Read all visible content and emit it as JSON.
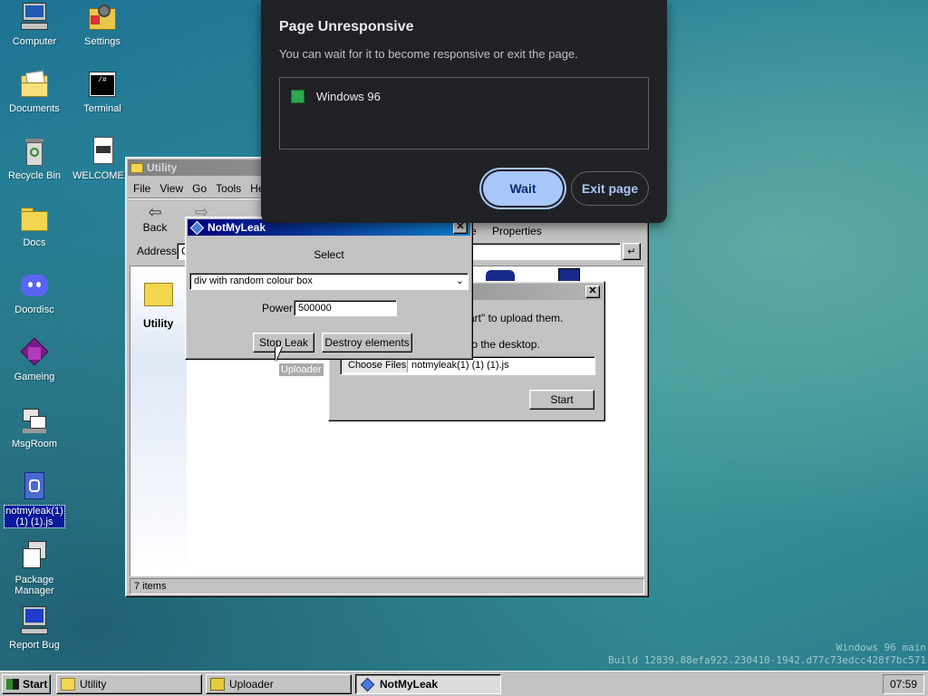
{
  "desktop": {
    "icons": [
      {
        "label": "Computer"
      },
      {
        "label": "Settings"
      },
      {
        "label": "Documents"
      },
      {
        "label": "Terminal"
      },
      {
        "label": "Recycle Bin"
      },
      {
        "label": "WELCOME..."
      },
      {
        "label": "Docs"
      },
      {
        "label": "Doordisc"
      },
      {
        "label": "Gameing"
      },
      {
        "label": "MsgRoom"
      },
      {
        "label": "notmyleak(1)\n(1) (1).js"
      },
      {
        "label": "Package\nManager"
      },
      {
        "label": "Report Bug"
      }
    ],
    "build_line1": "Windows 96 main",
    "build_line2": "Build 12839.88efa922.230410-1942.d77c73edcc428f7bc571"
  },
  "explorer": {
    "title": "Utility",
    "menu": [
      "File",
      "View",
      "Go",
      "Tools",
      "Help"
    ],
    "toolbar": {
      "back": "Back",
      "properties": "Properties",
      "partial": "e"
    },
    "address_label": "Address",
    "address_value": "C",
    "folder_label": "Utility",
    "status": "7 items"
  },
  "uploader": {
    "text1": "art\" to upload them.",
    "text2": "to the desktop.",
    "choose_files": "Choose Files",
    "file_name": "notmyleak(1) (1) (1).js",
    "start": "Start",
    "tooltip": "Uploader"
  },
  "notmyleak": {
    "title": "NotMyLeak",
    "select_label": "Select",
    "select_value": "div with random colour box",
    "power_label": "Power:",
    "power_value": "500000",
    "stop_button": "Stop Leak",
    "destroy_button": "Destroy elements"
  },
  "chrome_dialog": {
    "title": "Page Unresponsive",
    "message": "You can wait for it to become responsive or exit the page.",
    "page_name": "Windows 96",
    "wait": "Wait",
    "exit": "Exit page"
  },
  "taskbar": {
    "start": "Start",
    "tasks": [
      "Utility",
      "Uploader",
      "NotMyLeak"
    ],
    "clock": "07:59"
  },
  "colors": {
    "title_active": "#00007b",
    "chrome_bg": "#202124",
    "wait_pill": "#a8c7fa"
  }
}
